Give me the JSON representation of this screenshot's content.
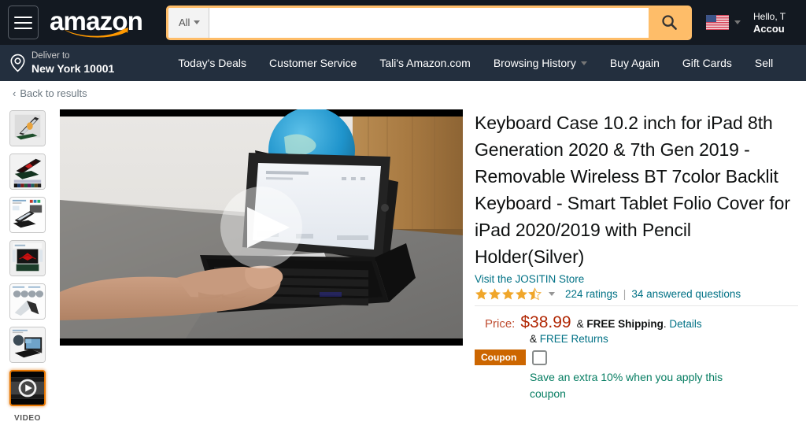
{
  "header": {
    "menu_icon": "hamburger-icon",
    "logo_text": "amazon",
    "search": {
      "category": "All",
      "value": "",
      "placeholder": "",
      "search_icon": "magnifying-glass-icon"
    },
    "locale": {
      "flag_icon": "us-flag-icon",
      "caret_icon": "chevron-down-icon"
    },
    "account": {
      "line1": "Hello, T",
      "line2": "Accou"
    },
    "colors": {
      "header_bg": "#131921",
      "subnav_bg": "#232f3e",
      "search_border": "#febd69",
      "search_button": "#febd69"
    }
  },
  "subnav": {
    "deliver_icon": "location-pin-icon",
    "deliver_label": "Deliver to",
    "deliver_value": "New York 10001",
    "links": [
      {
        "label": "Today's Deals",
        "has_caret": false
      },
      {
        "label": "Customer Service",
        "has_caret": false
      },
      {
        "label": "Tali's Amazon.com",
        "has_caret": false
      },
      {
        "label": "Browsing History",
        "has_caret": true
      },
      {
        "label": "Buy Again",
        "has_caret": false
      },
      {
        "label": "Gift Cards",
        "has_caret": false
      },
      {
        "label": "Sell",
        "has_caret": false
      }
    ]
  },
  "breadcrumb": {
    "chevron": "‹",
    "label": "Back to results"
  },
  "gallery": {
    "thumbnails": [
      {
        "name": "thumb-tablet-stand-green",
        "selected": false
      },
      {
        "name": "thumb-backlit-colors",
        "selected": false
      },
      {
        "name": "thumb-features-grid",
        "selected": false
      },
      {
        "name": "thumb-red-backlight",
        "selected": false
      },
      {
        "name": "thumb-folio-angles",
        "selected": false
      },
      {
        "name": "thumb-globe-desk",
        "selected": false
      },
      {
        "name": "thumb-video",
        "selected": true
      }
    ],
    "video_label": "VIDEO",
    "main_media": {
      "type": "video",
      "play_icon": "play-button-icon",
      "alt": "Hands typing on black keyboard case with iPad on gray fabric, blue globe and wood panel in background"
    }
  },
  "product": {
    "title": "Keyboard Case 10.2 inch for iPad 8th Generation 2020 & 7th Gen 2019 - Removable Wireless BT 7color Backlit Keyboard - Smart Tablet Folio Cover for iPad 2020/2019 with Pencil Holder(Silver)",
    "store_link": "Visit the JOSITIN Store",
    "rating_value": 4.5,
    "rating_caret_icon": "chevron-down-icon",
    "ratings_count": "224 ratings",
    "separator": "|",
    "answered_questions": "34 answered questions",
    "price_label": "Price:",
    "price_value": "$38.99",
    "shipping_prefix": "&",
    "shipping_free": "FREE Shipping",
    "shipping_period": ".",
    "shipping_details_link": "Details",
    "returns_prefix": "&",
    "returns_link": "FREE Returns",
    "coupon_badge": "Coupon",
    "coupon_checkbox_checked": false,
    "coupon_text": "Save an extra 10% when you apply this coupon",
    "colors": {
      "price": "#b12704",
      "link": "#007185",
      "coupon_badge": "#cc6600",
      "coupon_text": "#067d62",
      "star": "#f0a62a"
    }
  }
}
